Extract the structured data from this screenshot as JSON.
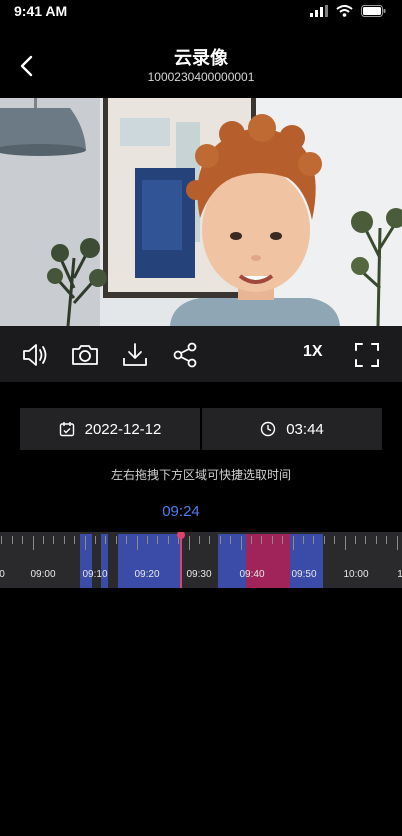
{
  "status": {
    "time": "9:41 AM"
  },
  "header": {
    "title": "云录像",
    "device_id": "1000230400000001"
  },
  "controls": {
    "speed": "1X"
  },
  "picker": {
    "date": "2022-12-12",
    "time": "03:44"
  },
  "hint": "左右拖拽下方区域可快捷选取时间",
  "timeline": {
    "current_time": "09:24",
    "labels": [
      "0",
      "09:00",
      "09:10",
      "09:20",
      "09:30",
      "09:40",
      "09:50",
      "10:00",
      "1"
    ]
  },
  "colors": {
    "accent": "#4d7ef0",
    "recording": "#3a4ba8",
    "alarm": "#a0245a",
    "cursor": "#e2416d"
  }
}
